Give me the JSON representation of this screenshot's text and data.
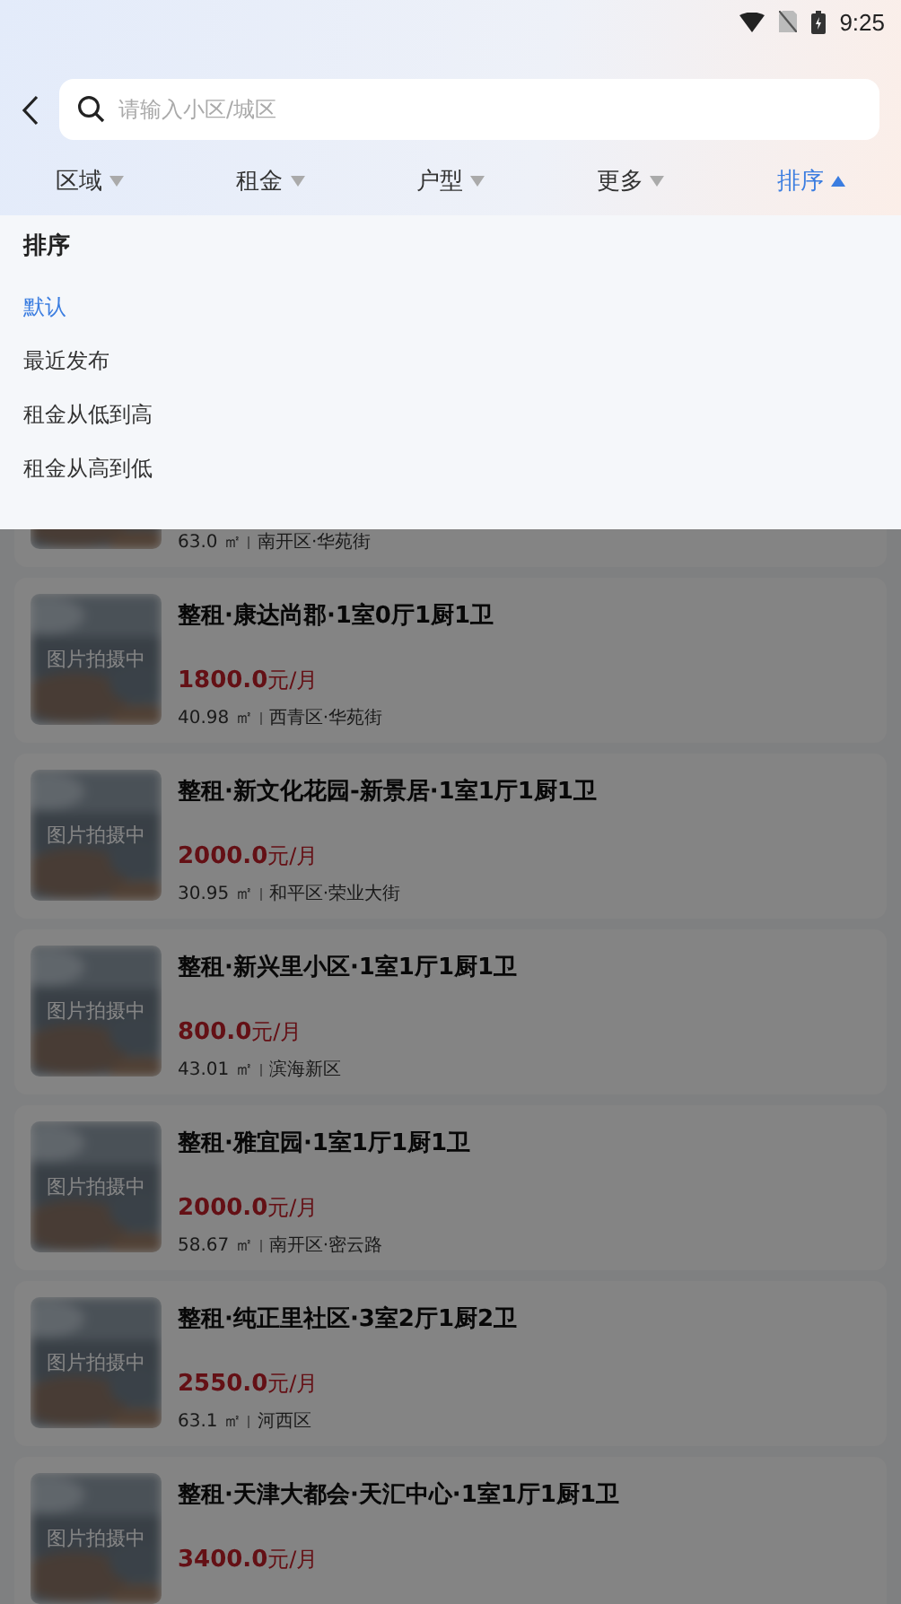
{
  "status_bar": {
    "time": "9:25"
  },
  "search": {
    "placeholder": "请输入小区/城区"
  },
  "filters": [
    {
      "label": "区域",
      "selected": false
    },
    {
      "label": "租金",
      "selected": false
    },
    {
      "label": "户型",
      "selected": false
    },
    {
      "label": "更多",
      "selected": false
    },
    {
      "label": "排序",
      "selected": true
    }
  ],
  "sort_panel": {
    "title": "排序",
    "options": [
      {
        "label": "默认",
        "selected": true
      },
      {
        "label": "最近发布",
        "selected": false
      },
      {
        "label": "租金从低到高",
        "selected": false
      },
      {
        "label": "租金从高到低",
        "selected": false
      }
    ]
  },
  "listings": [
    {
      "area": "63.0 ㎡",
      "location": "南开区·华苑街"
    },
    {
      "image_label": "图片拍摄中",
      "title": "整租·康达尚郡·1室0厅1厨1卫",
      "price": "1800.0",
      "unit": "元/月",
      "area": "40.98 ㎡",
      "location": "西青区·华苑街"
    },
    {
      "image_label": "图片拍摄中",
      "title": "整租·新文化花园-新景居·1室1厅1厨1卫",
      "price": "2000.0",
      "unit": "元/月",
      "area": "30.95 ㎡",
      "location": "和平区·荣业大街"
    },
    {
      "image_label": "图片拍摄中",
      "title": "整租·新兴里小区·1室1厅1厨1卫",
      "price": "800.0",
      "unit": "元/月",
      "area": "43.01 ㎡",
      "location": "滨海新区"
    },
    {
      "image_label": "图片拍摄中",
      "title": "整租·雅宜园·1室1厅1厨1卫",
      "price": "2000.0",
      "unit": "元/月",
      "area": "58.67 ㎡",
      "location": "南开区·密云路"
    },
    {
      "image_label": "图片拍摄中",
      "title": "整租·纯正里社区·3室2厅1厨2卫",
      "price": "2550.0",
      "unit": "元/月",
      "area": "63.1 ㎡",
      "location": "河西区"
    },
    {
      "image_label": "图片拍摄中",
      "title": "整租·天津大都会·天汇中心·1室1厅1厨1卫",
      "price": "3400.0",
      "unit": "元/月"
    }
  ]
}
